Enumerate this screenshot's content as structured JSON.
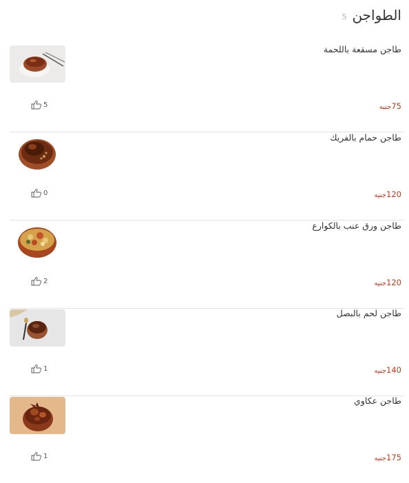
{
  "section": {
    "title": "الطواجن",
    "count": "5"
  },
  "currency": "جنيه",
  "items": [
    {
      "name": "طاجن مسقعة باللحمة",
      "price": "75",
      "likes": "5"
    },
    {
      "name": "طاجن حمام بالفريك",
      "price": "120",
      "likes": "0"
    },
    {
      "name": "طاجن ورق عنب بالكوارع",
      "price": "120",
      "likes": "2"
    },
    {
      "name": "طاجن لحم بالبصل",
      "price": "140",
      "likes": "1"
    },
    {
      "name": "طاجن عكاوي",
      "price": "175",
      "likes": "1"
    }
  ],
  "icons": {
    "like": "thumbs-up-icon"
  },
  "colors": {
    "price": "#c8381f",
    "title": "#333333",
    "divider": "#e2e2e2"
  }
}
